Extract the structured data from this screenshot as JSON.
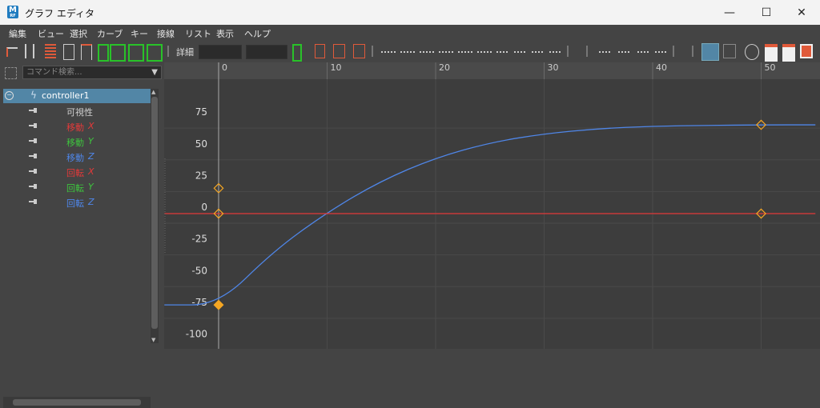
{
  "window": {
    "title": "グラフ エディタ",
    "app_icon_letter": "M",
    "app_icon_sub": "RF",
    "minimize_glyph": "—",
    "maximize_glyph": "☐",
    "close_glyph": "✕"
  },
  "menu": [
    "編集",
    "ビュー",
    "選択",
    "カーブ",
    "キー",
    "接線",
    "リスト",
    "表示",
    "ヘルプ"
  ],
  "toolbar": {
    "detail_label": "詳細"
  },
  "left_panel": {
    "search_placeholder": "コマンド検索...",
    "dropdown_glyph": "▼",
    "tree": [
      {
        "label": "controller1",
        "color": "#ffffff",
        "selected": true,
        "axis": ""
      },
      {
        "label": "可視性",
        "color": "#d0d0d0",
        "selected": false,
        "axis": ""
      },
      {
        "label": "移動",
        "color": "#e23a3a",
        "selected": false,
        "axis": "X"
      },
      {
        "label": "移動",
        "color": "#3ec43e",
        "selected": false,
        "axis": "Y"
      },
      {
        "label": "移動",
        "color": "#4f86e8",
        "selected": false,
        "axis": "Z"
      },
      {
        "label": "回転",
        "color": "#e23a3a",
        "selected": false,
        "axis": "X"
      },
      {
        "label": "回転",
        "color": "#3ec43e",
        "selected": false,
        "axis": "Y"
      },
      {
        "label": "回転",
        "color": "#4f86e8",
        "selected": false,
        "axis": "Z"
      }
    ]
  },
  "chart_data": {
    "type": "line",
    "x_ticks": [
      0,
      10,
      20,
      30,
      40,
      50
    ],
    "y_ticks": [
      75,
      50,
      25,
      0,
      -25,
      -50,
      -75,
      -100
    ],
    "xlim": [
      -5,
      55
    ],
    "ylim": [
      -110,
      87
    ],
    "series": [
      {
        "color": "#4f86e8",
        "points": [
          [
            -5,
            -72
          ],
          [
            0,
            -72
          ],
          [
            5,
            -30
          ],
          [
            10,
            1
          ],
          [
            15,
            26
          ],
          [
            20,
            44
          ],
          [
            25,
            56
          ],
          [
            30,
            63
          ],
          [
            35,
            67
          ],
          [
            40,
            69
          ],
          [
            45,
            69.5
          ],
          [
            50,
            70
          ],
          [
            55,
            70
          ]
        ],
        "keys": [
          [
            0,
            -72
          ],
          [
            50,
            70
          ]
        ],
        "tangent_handle": [
          0,
          20
        ]
      },
      {
        "color": "#e23a3a",
        "points": [
          [
            -5,
            0
          ],
          [
            55,
            0
          ]
        ],
        "keys": [
          [
            0,
            0
          ],
          [
            50,
            0
          ]
        ]
      }
    ],
    "grid": true,
    "key_color": "#f5a623"
  }
}
